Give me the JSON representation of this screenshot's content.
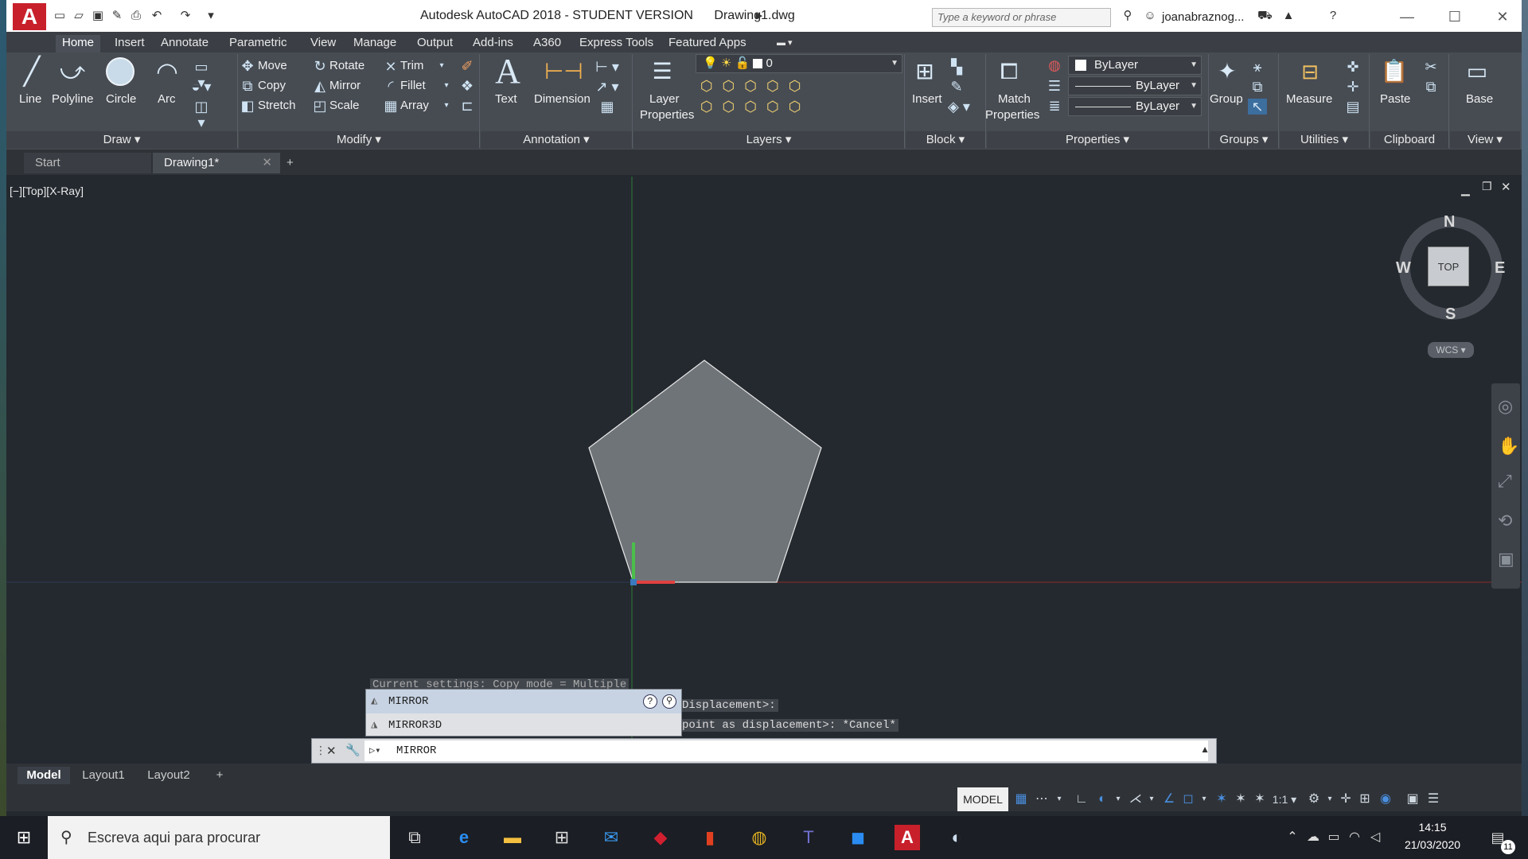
{
  "window": {
    "app_logo": "A",
    "title": "Autodesk AutoCAD 2018 - STUDENT VERSION",
    "document": "Drawing1.dwg",
    "search_placeholder": "Type a keyword or phrase",
    "user": "joanabraznog..."
  },
  "ribbon_tabs": [
    "Home",
    "Insert",
    "Annotate",
    "Parametric",
    "View",
    "Manage",
    "Output",
    "Add-ins",
    "A360",
    "Express Tools",
    "Featured Apps"
  ],
  "draw": {
    "line": "Line",
    "polyline": "Polyline",
    "circle": "Circle",
    "arc": "Arc",
    "panel": "Draw"
  },
  "modify": {
    "move": "Move",
    "rotate": "Rotate",
    "trim": "Trim",
    "copy": "Copy",
    "mirror": "Mirror",
    "fillet": "Fillet",
    "stretch": "Stretch",
    "scale": "Scale",
    "array": "Array",
    "panel": "Modify"
  },
  "annotation": {
    "text": "Text",
    "dimension": "Dimension",
    "panel": "Annotation"
  },
  "layers": {
    "layer_properties_1": "Layer",
    "layer_properties_2": "Properties",
    "current_layer": "0",
    "panel": "Layers"
  },
  "block": {
    "insert": "Insert",
    "panel": "Block"
  },
  "properties": {
    "match_1": "Match",
    "match_2": "Properties",
    "color": "ByLayer",
    "linetype": "ByLayer",
    "lineweight": "ByLayer",
    "panel": "Properties"
  },
  "groups": {
    "group": "Group",
    "panel": "Groups"
  },
  "utilities": {
    "measure": "Measure",
    "panel": "Utilities"
  },
  "clipboard": {
    "paste": "Paste",
    "panel": "Clipboard"
  },
  "view": {
    "base": "Base",
    "panel": "View"
  },
  "file_tabs": {
    "start": "Start",
    "drawing": "Drawing1*"
  },
  "viewport": {
    "label": "[−][Top][X-Ray]"
  },
  "viewcube": {
    "n": "N",
    "s": "S",
    "e": "E",
    "w": "W",
    "face": "TOP",
    "wcs": "WCS"
  },
  "command": {
    "history_1": "Current settings:  Copy mode = Multiple",
    "history_2": "Displacement>:",
    "history_3": "point as displacement>: *Cancel*",
    "suggestions": [
      "MIRROR",
      "MIRROR3D"
    ],
    "input": "MIRROR"
  },
  "layout_tabs": [
    "Model",
    "Layout1",
    "Layout2"
  ],
  "status": {
    "model": "MODEL",
    "scale": "1:1"
  },
  "taskbar": {
    "search": "Escreva aqui para procurar",
    "time": "14:15",
    "date": "21/03/2020",
    "notifications": "11"
  },
  "colors": {
    "accent": "#c8202b",
    "ribbon": "#474c53",
    "canvas": "#24292f"
  }
}
